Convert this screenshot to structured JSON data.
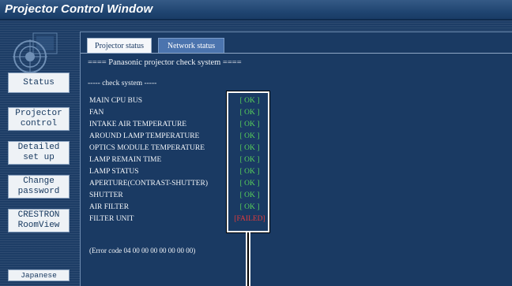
{
  "window": {
    "title": "Projector Control Window"
  },
  "sidebar": {
    "logo_icon": "projector-lens-logo",
    "buttons": [
      {
        "label": "Status"
      },
      {
        "label": "Projector\ncontrol"
      },
      {
        "label": "Detailed\nset up"
      },
      {
        "label": "Change\npassword"
      },
      {
        "label": "CRESTRON\nRoomView"
      },
      {
        "label": "Japanese"
      }
    ]
  },
  "tabs": [
    {
      "label": "Projector status",
      "active": true
    },
    {
      "label": "Network status",
      "active": false
    }
  ],
  "main": {
    "heading": "==== Panasonic projector check system ====",
    "subheading": "----- check system -----",
    "checks": [
      {
        "label": "MAIN CPU BUS",
        "status": "[ OK ]",
        "state": "ok"
      },
      {
        "label": "FAN",
        "status": "[ OK ]",
        "state": "ok"
      },
      {
        "label": "INTAKE AIR TEMPERATURE",
        "status": "[ OK ]",
        "state": "ok"
      },
      {
        "label": "AROUND LAMP TEMPERATURE",
        "status": "[ OK ]",
        "state": "ok"
      },
      {
        "label": "OPTICS MODULE TEMPERATURE",
        "status": "[ OK ]",
        "state": "ok"
      },
      {
        "label": "LAMP REMAIN TIME",
        "status": "[ OK ]",
        "state": "ok"
      },
      {
        "label": "LAMP STATUS",
        "status": "[ OK ]",
        "state": "ok"
      },
      {
        "label": "APERTURE(CONTRAST-SHUTTER)",
        "status": "[ OK ]",
        "state": "ok"
      },
      {
        "label": "SHUTTER",
        "status": "[ OK ]",
        "state": "ok"
      },
      {
        "label": "AIR FILTER",
        "status": "[ OK ]",
        "state": "ok"
      },
      {
        "label": "FILTER UNIT",
        "status": "[FAILED]",
        "state": "failed"
      }
    ],
    "error_code": "(Error code 04 00 00 00 00 00 00 00)"
  },
  "colors": {
    "ok": "#59d35b",
    "failed": "#e23a3a",
    "background": "#1a3a63",
    "title_bar": "#1f4470"
  }
}
